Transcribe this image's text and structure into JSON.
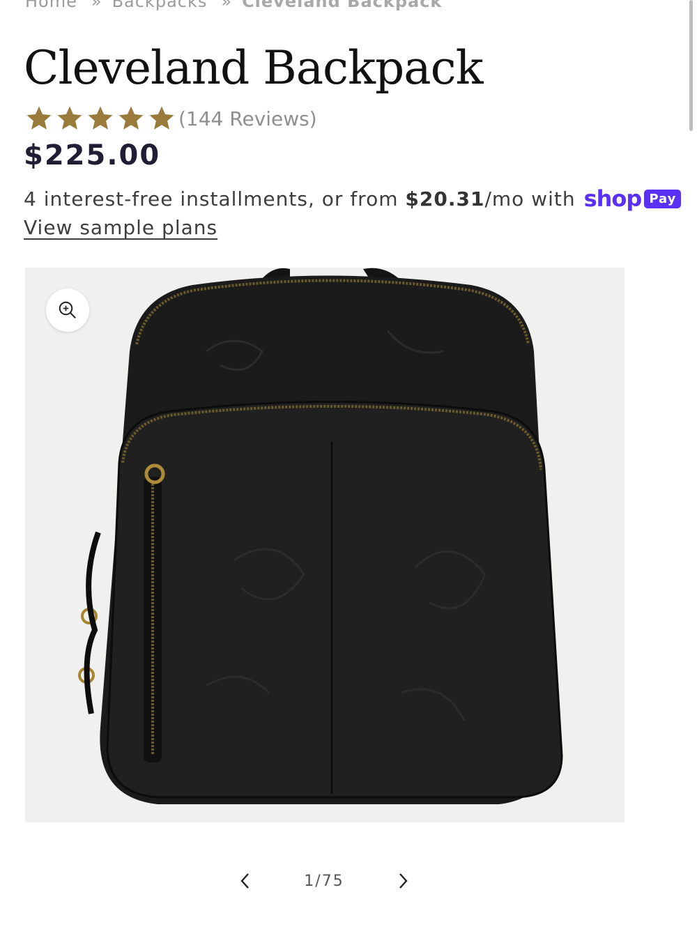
{
  "breadcrumb": {
    "items": [
      "Home",
      "Backpacks",
      "Cleveland Backpack"
    ],
    "separator": "»"
  },
  "product": {
    "title": "Cleveland Backpack",
    "rating": {
      "stars": 5,
      "reviews_label": "(144 Reviews)",
      "star_color": "#9a7b3c"
    },
    "price": "$225.00",
    "installments": {
      "prefix": "4 interest-free installments, or from ",
      "amount": "$20.31",
      "suffix": "/mo with",
      "shop_text": "shop",
      "pay_text": "Pay",
      "link": "View sample plans"
    },
    "image": {
      "alt": "Black embossed leather backpack",
      "icon": "zoom-in-icon"
    }
  },
  "gallery": {
    "counter": "1/75",
    "prev_icon": "chevron-left-icon",
    "next_icon": "chevron-right-icon"
  },
  "colors": {
    "shoppay": "#5a31f4",
    "star": "#9a7b3c",
    "price": "#221c35"
  }
}
